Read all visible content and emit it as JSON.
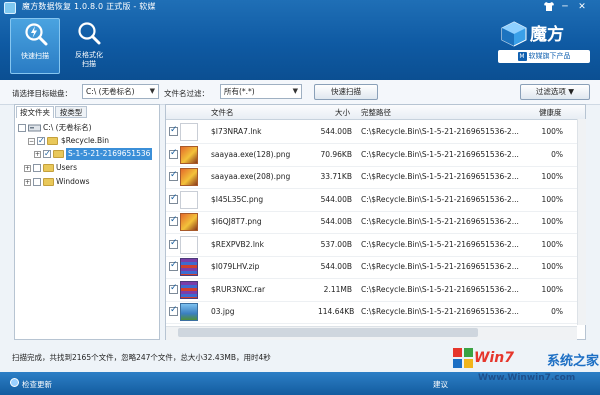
{
  "window": {
    "title": "魔方数据恢复 1.0.8.0 正式版 - 软媒",
    "controls": [
      "shirt-icon",
      "minimize-icon",
      "close-icon"
    ]
  },
  "toolbar": {
    "quick_scan": "快速扫描",
    "format_scan_line1": "反格式化",
    "format_scan_line2": "扫描"
  },
  "brand": {
    "name": "魔方",
    "sub_m": "M",
    "sub": "软媒旗下产品"
  },
  "filters": {
    "drive_label": "请选择目标磁盘：",
    "drive_value": "C:\\  (无卷标名)",
    "filter_label": "文件名过滤：",
    "filter_value": "所有(*.*)",
    "scan_button": "快速扫描",
    "filter_options_button": "过滤选项"
  },
  "left_panel": {
    "tabs": [
      "按文件夹",
      "按类型"
    ],
    "tree": [
      {
        "label": "C:\\  (无卷标名)",
        "level": 0
      },
      {
        "label": "$Recycle.Bin",
        "level": 1
      },
      {
        "label": "S-1-5-21-2169651536",
        "level": 2,
        "selected": true
      },
      {
        "label": "Users",
        "level": 1
      },
      {
        "label": "Windows",
        "level": 1
      }
    ]
  },
  "grid": {
    "columns": [
      "文件名",
      "大小",
      "完整路径",
      "健康度"
    ],
    "rows": [
      {
        "icon": "lnk",
        "name": "$I73NRA7.lnk",
        "size": "544.00B",
        "path": "C:\\$Recycle.Bin\\S-1-5-21-2169651536-2...",
        "health": "100%"
      },
      {
        "icon": "png",
        "name": "saayaa.exe(128).png",
        "size": "70.96KB",
        "path": "C:\\$Recycle.Bin\\S-1-5-21-2169651536-2...",
        "health": "0%"
      },
      {
        "icon": "png",
        "name": "saayaa.exe(208).png",
        "size": "33.71KB",
        "path": "C:\\$Recycle.Bin\\S-1-5-21-2169651536-2...",
        "health": "100%"
      },
      {
        "icon": "lnk",
        "name": "$I45L35C.png",
        "size": "544.00B",
        "path": "C:\\$Recycle.Bin\\S-1-5-21-2169651536-2...",
        "health": "100%"
      },
      {
        "icon": "png",
        "name": "$I6QJ8T7.png",
        "size": "544.00B",
        "path": "C:\\$Recycle.Bin\\S-1-5-21-2169651536-2...",
        "health": "100%"
      },
      {
        "icon": "lnk",
        "name": "$REXPVB2.lnk",
        "size": "537.00B",
        "path": "C:\\$Recycle.Bin\\S-1-5-21-2169651536-2...",
        "health": "100%"
      },
      {
        "icon": "zip",
        "name": "$I079LHV.zip",
        "size": "544.00B",
        "path": "C:\\$Recycle.Bin\\S-1-5-21-2169651536-2...",
        "health": "100%"
      },
      {
        "icon": "rar",
        "name": "$RUR3NXC.rar",
        "size": "2.11MB",
        "path": "C:\\$Recycle.Bin\\S-1-5-21-2169651536-2...",
        "health": "100%"
      },
      {
        "icon": "jpg",
        "name": "03.jpg",
        "size": "114.64KB",
        "path": "C:\\$Recycle.Bin\\S-1-5-21-2169651536-2...",
        "health": "0%"
      }
    ]
  },
  "status": "扫描完成，共找到2165个文件，忽略247个文件，总大小32.43MB，用时4秒",
  "bottom": {
    "update": "检查更新",
    "feedback": "建议"
  },
  "watermark": {
    "part1": "Win7",
    "part2": "系统之家",
    "url": "Www.Winwin7.com"
  }
}
